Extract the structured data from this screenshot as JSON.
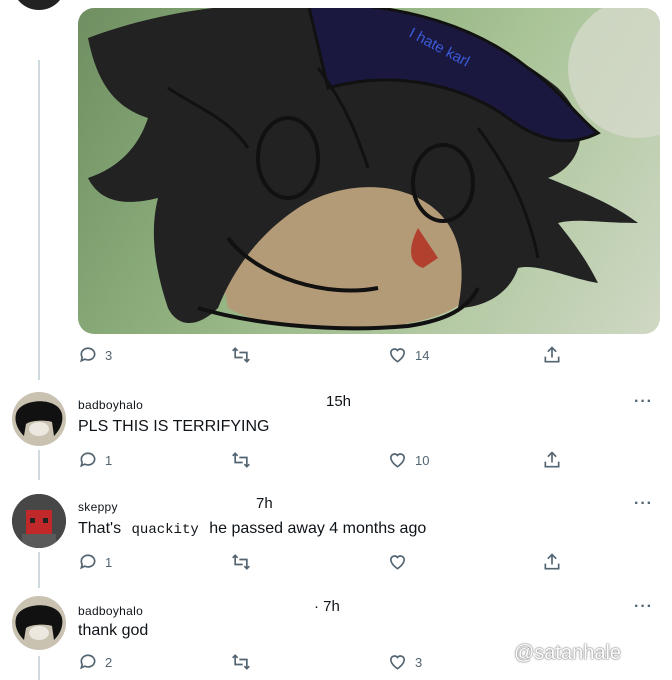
{
  "post": {
    "media_drawing_text": "I hate karl",
    "stats": {
      "replies": "3",
      "retweets": "",
      "likes": "14"
    }
  },
  "replies": [
    {
      "username": "badboyhalo",
      "time": "15h",
      "text": "PLS THIS IS TERRIFYING",
      "stats": {
        "replies": "1",
        "retweets": "",
        "likes": "10"
      }
    },
    {
      "username": "skeppy",
      "time": "7h",
      "text_prefix": "That's",
      "text_insert": "quackity",
      "text_suffix": "he passed away 4 months ago",
      "stats": {
        "replies": "1",
        "retweets": "",
        "likes": ""
      }
    },
    {
      "username": "badboyhalo",
      "time": "· 7h",
      "text": "thank god",
      "stats": {
        "replies": "2",
        "retweets": "",
        "likes": "3"
      }
    }
  ],
  "more_label": "···",
  "watermark": {
    "handle": "@satanhale",
    "icon": "tiktok-icon"
  },
  "colors": {
    "icon": "#536471",
    "thread_line": "#cfd9de",
    "hat": "#1b1840",
    "hat_text": "#3a5bd9"
  }
}
